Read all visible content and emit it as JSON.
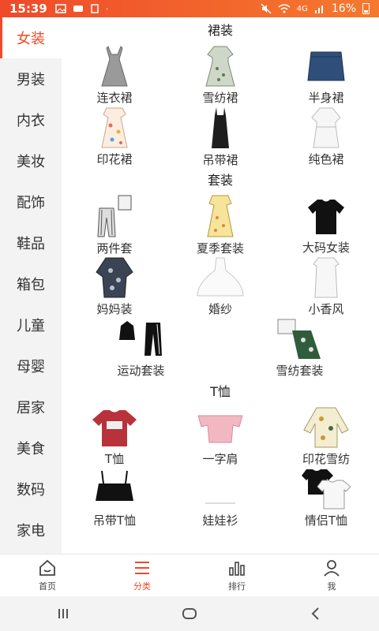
{
  "status_bar": {
    "time": "15:39",
    "battery": "16%",
    "signal": "4G"
  },
  "sidebar": {
    "items": [
      {
        "label": "女装",
        "active": true
      },
      {
        "label": "男装"
      },
      {
        "label": "内衣"
      },
      {
        "label": "美妆"
      },
      {
        "label": "配饰"
      },
      {
        "label": "鞋品"
      },
      {
        "label": "箱包"
      },
      {
        "label": "儿童"
      },
      {
        "label": "母婴"
      },
      {
        "label": "居家"
      },
      {
        "label": "美食"
      },
      {
        "label": "数码"
      },
      {
        "label": "家电"
      }
    ]
  },
  "sections": [
    {
      "title": "裙装",
      "items": [
        {
          "label": "连衣裙",
          "icon": "grey-dress-icon"
        },
        {
          "label": "雪纺裙",
          "icon": "floral-dress-icon"
        },
        {
          "label": "半身裙",
          "icon": "denim-skirt-icon"
        },
        {
          "label": "印花裙",
          "icon": "print-dress-icon"
        },
        {
          "label": "吊带裙",
          "icon": "slip-dress-icon"
        },
        {
          "label": "纯色裙",
          "icon": "white-dress-icon"
        }
      ]
    },
    {
      "title": "套装",
      "items": [
        {
          "label": "两件套",
          "icon": "two-piece-icon"
        },
        {
          "label": "夏季套装",
          "icon": "summer-set-icon"
        },
        {
          "label": "大码女装",
          "icon": "black-tee-icon"
        },
        {
          "label": "妈妈装",
          "icon": "mom-wear-icon"
        },
        {
          "label": "婚纱",
          "icon": "wedding-dress-icon"
        },
        {
          "label": "小香风",
          "icon": "white-mini-icon"
        }
      ],
      "wide_items": [
        {
          "label": "运动套装",
          "icon": "sport-set-icon"
        },
        {
          "label": "雪纺套装",
          "icon": "chiffon-set-icon"
        }
      ]
    },
    {
      "title": "T恤",
      "items": [
        {
          "label": "T恤",
          "icon": "red-tee-icon"
        },
        {
          "label": "一字肩",
          "icon": "offshoulder-top-icon"
        },
        {
          "label": "印花雪纺",
          "icon": "print-blouse-icon"
        },
        {
          "label": "吊带T恤",
          "icon": "black-cami-icon"
        },
        {
          "label": "娃娃衫",
          "icon": "doll-shirt-icon"
        },
        {
          "label": "情侣T恤",
          "icon": "couple-tee-icon"
        }
      ]
    }
  ],
  "bottom_nav": [
    {
      "label": "首页",
      "icon": "home-icon"
    },
    {
      "label": "分类",
      "icon": "menu-icon",
      "active": true
    },
    {
      "label": "排行",
      "icon": "bar-chart-icon"
    },
    {
      "label": "我",
      "icon": "user-icon"
    }
  ],
  "colors": {
    "accent": "#ef4a2a",
    "sidebar_bg": "#f3f3f3"
  }
}
